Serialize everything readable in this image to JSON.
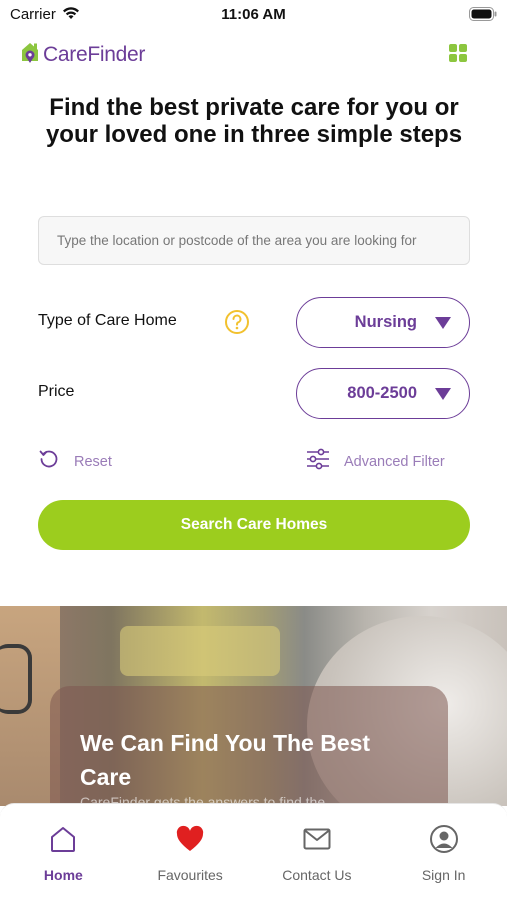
{
  "status_bar": {
    "carrier": "Carrier",
    "time": "11:06 AM"
  },
  "header": {
    "logo_text": "CareFinder"
  },
  "headline": "Find the best private care for you or your loved one in three simple steps",
  "search": {
    "placeholder": "Type the location or postcode of the area you are looking for"
  },
  "care_type": {
    "label": "Type of Care Home",
    "value": "Nursing"
  },
  "price": {
    "label": "Price",
    "value": "800-2500"
  },
  "actions": {
    "reset": "Reset",
    "advanced_filter": "Advanced Filter"
  },
  "search_button": "Search Care Homes",
  "banner": {
    "title": "We Can Find You The Best Care",
    "subtitle": "CareFinder gets the answers to find the"
  },
  "tabs": [
    {
      "label": "Home",
      "icon": "home-icon",
      "active": true
    },
    {
      "label": "Favourites",
      "icon": "heart-icon",
      "active": false
    },
    {
      "label": "Contact Us",
      "icon": "mail-icon",
      "active": false
    },
    {
      "label": "Sign In",
      "icon": "user-icon",
      "active": false
    }
  ],
  "colors": {
    "brand_purple": "#6c3d98",
    "brand_green": "#9ccd1e",
    "help_yellow": "#f2c12e",
    "heart_red": "#e02020"
  }
}
